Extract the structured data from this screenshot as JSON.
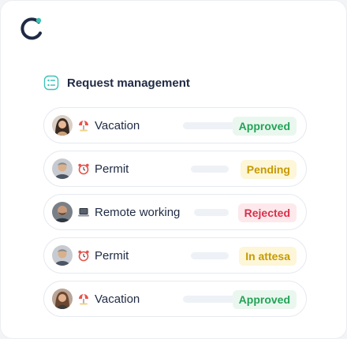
{
  "header": {
    "logo": "circle-logo-icon",
    "title": "Request management",
    "title_icon": "checklist-icon"
  },
  "requests": [
    {
      "avatar": "avatar-woman-dark-hair",
      "icon": "beach-umbrella-icon",
      "type": "Vacation",
      "status": "Approved",
      "status_kind": "approved"
    },
    {
      "avatar": "avatar-man-gray-hair",
      "icon": "alarm-clock-icon",
      "type": "Permit",
      "status": "Pending",
      "status_kind": "pending"
    },
    {
      "avatar": "avatar-man-bald-beard",
      "icon": "laptop-icon",
      "type": "Remote working",
      "status": "Rejected",
      "status_kind": "rejected"
    },
    {
      "avatar": "avatar-man-gray-hair",
      "icon": "alarm-clock-icon",
      "type": "Permit",
      "status": "In attesa",
      "status_kind": "pending"
    },
    {
      "avatar": "avatar-woman-brown-hair",
      "icon": "beach-umbrella-icon",
      "type": "Vacation",
      "status": "Approved",
      "status_kind": "approved"
    }
  ],
  "colors": {
    "brand": "#1f2a44",
    "accent": "#3cc3b8",
    "approved": "#22a356",
    "pending": "#c79a00",
    "rejected": "#d9304a"
  }
}
